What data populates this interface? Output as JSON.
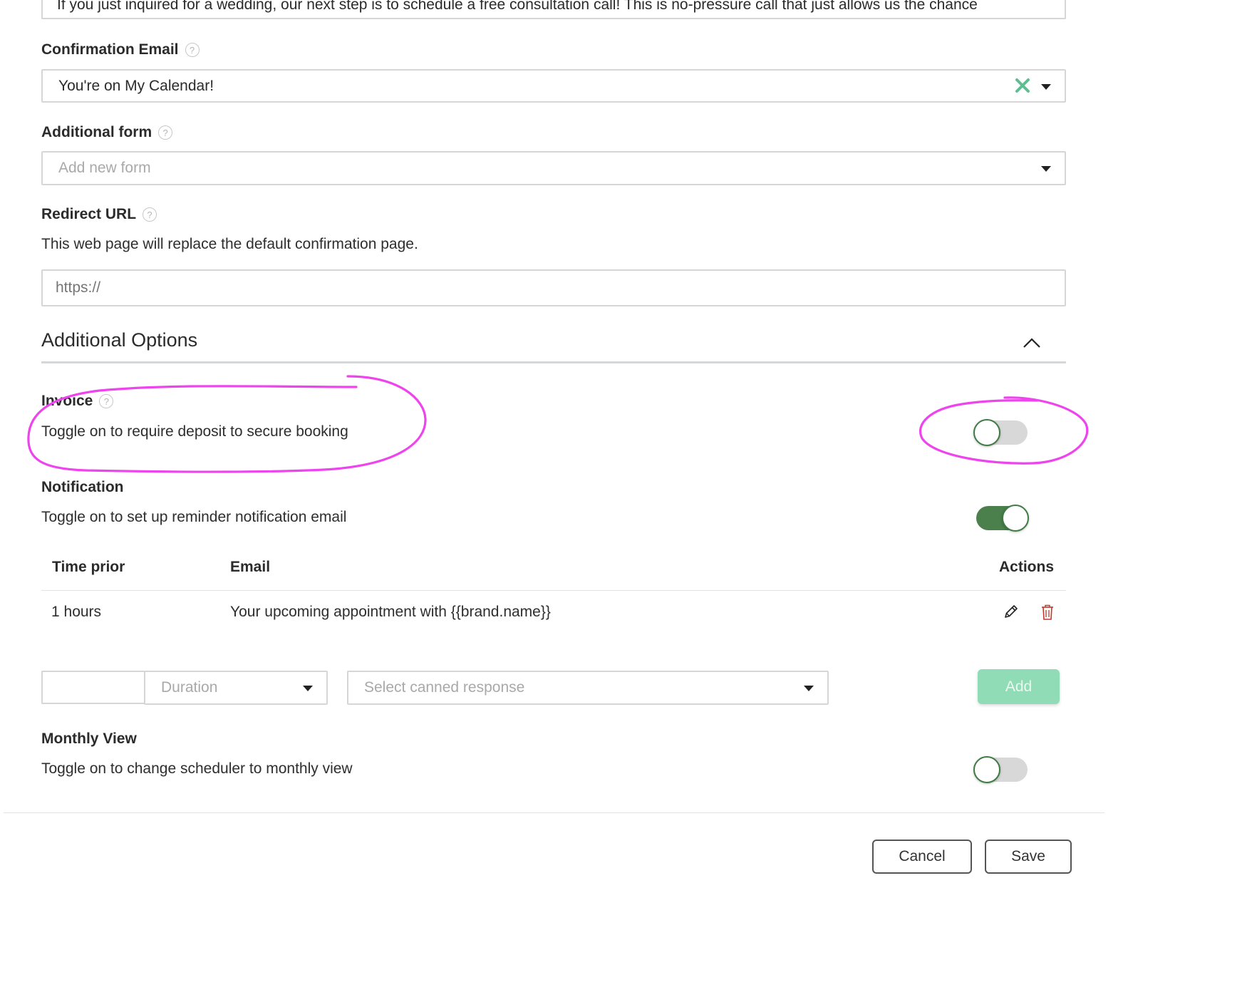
{
  "message_preview": "If you just inquired for a wedding, our next step is to schedule a free consultation call! This is no-pressure call that just allows us the chance",
  "confirmation_email": {
    "label": "Confirmation Email",
    "help": "?",
    "value": "You're on My Calendar!"
  },
  "additional_form": {
    "label": "Additional form",
    "help": "?",
    "placeholder": "Add new form"
  },
  "redirect_url": {
    "label": "Redirect URL",
    "help": "?",
    "description": "This web page will replace the default confirmation page.",
    "placeholder": "https://"
  },
  "additional_options": {
    "title": "Additional Options"
  },
  "invoice": {
    "label": "Invoice",
    "help": "?",
    "description": "Toggle on to require deposit to secure booking",
    "enabled": false
  },
  "notification": {
    "label": "Notification",
    "description": "Toggle on to set up reminder notification email",
    "enabled": true,
    "table": {
      "headers": {
        "time_prior": "Time prior",
        "email": "Email",
        "actions": "Actions"
      },
      "rows": [
        {
          "time_prior": "1 hours",
          "email": "Your upcoming appointment with {{brand.name}}"
        }
      ]
    },
    "add_row": {
      "duration_placeholder": "Duration",
      "response_placeholder": "Select canned response",
      "add_label": "Add"
    }
  },
  "monthly_view": {
    "label": "Monthly View",
    "description": "Toggle on to change scheduler to monthly view",
    "enabled": false
  },
  "footer": {
    "cancel_label": "Cancel",
    "save_label": "Save"
  },
  "colors": {
    "annotation": "#ee44ee",
    "toggle_on": "#4b7f4c",
    "clear_icon": "#5dbf8f",
    "add_button": "#8fdcb6",
    "delete_icon": "#c0392b"
  }
}
